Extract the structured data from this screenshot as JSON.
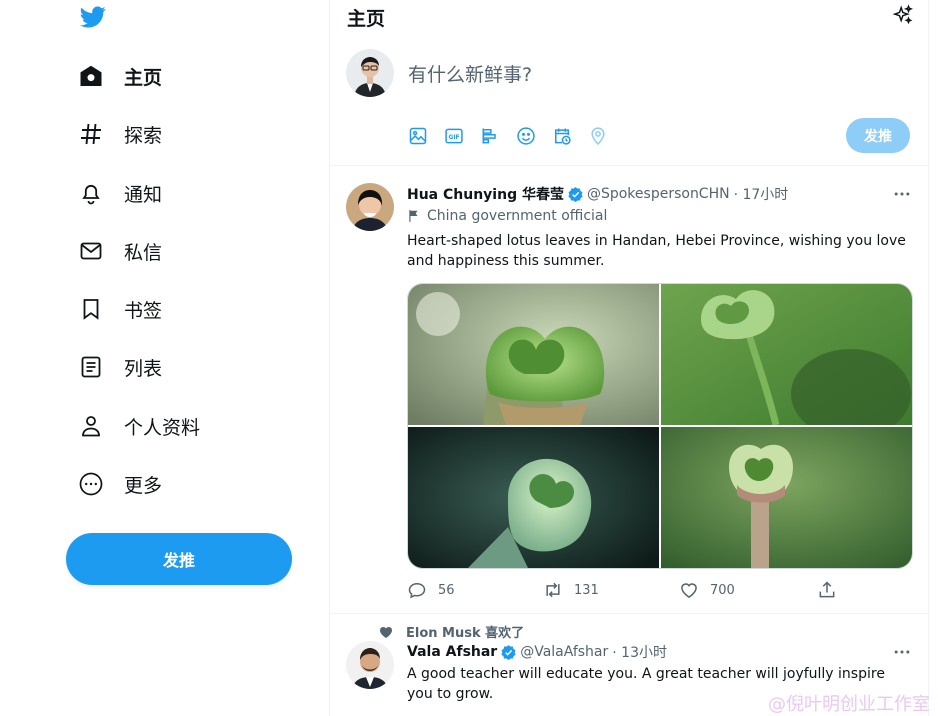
{
  "sidebar": {
    "logo": "twitter-bird-icon",
    "items": [
      {
        "label": "主页",
        "icon": "home-icon",
        "active": true
      },
      {
        "label": "探索",
        "icon": "hashtag-icon"
      },
      {
        "label": "通知",
        "icon": "bell-icon"
      },
      {
        "label": "私信",
        "icon": "envelope-icon"
      },
      {
        "label": "书签",
        "icon": "bookmark-icon"
      },
      {
        "label": "列表",
        "icon": "list-icon"
      },
      {
        "label": "个人资料",
        "icon": "person-icon"
      },
      {
        "label": "更多",
        "icon": "more-circle-icon"
      }
    ],
    "tweet_button": "发推"
  },
  "header": {
    "title": "主页",
    "icon": "sparkle-icon"
  },
  "composer": {
    "placeholder": "有什么新鲜事?",
    "tools": [
      "image-icon",
      "gif-icon",
      "poll-icon",
      "emoji-icon",
      "schedule-icon",
      "location-icon"
    ],
    "post_button": "发推"
  },
  "tweets": [
    {
      "name": "Hua Chunying 华春莹",
      "handle": "@SpokespersonCHN",
      "time": "· 17小时",
      "label": "China government official",
      "text": "Heart-shaped lotus leaves in Handan, Hebei Province, wishing you love and happiness this summer.",
      "replies": "56",
      "retweets": "131",
      "likes": "700"
    },
    {
      "social_context": "Elon Musk 喜欢了",
      "name": "Vala Afshar",
      "handle": "@ValaAfshar",
      "time": "· 13小时",
      "text": "A good teacher will educate you. A great teacher will joyfully inspire you to grow."
    }
  ],
  "watermark": "@倪叶明创业工作室",
  "colors": {
    "accent": "#1d9bf0",
    "accent_disabled": "#8ecdf7",
    "text": "#0f1419",
    "secondary": "#536471"
  }
}
